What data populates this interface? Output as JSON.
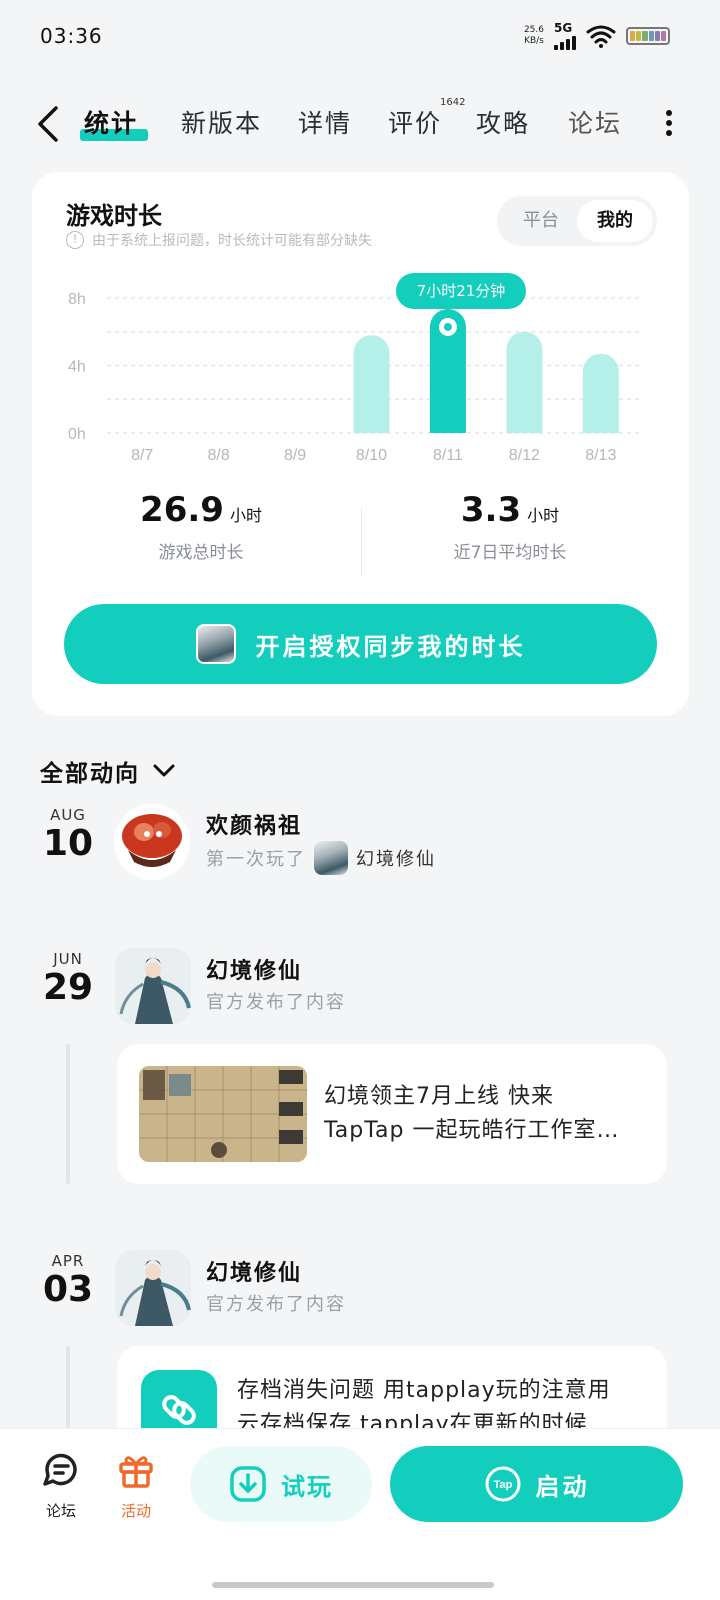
{
  "status_bar": {
    "time": "03:36",
    "net_speed_value": "25.6",
    "net_speed_unit": "KB/s",
    "network": "5G"
  },
  "nav": {
    "tabs": [
      {
        "label": "统计",
        "active": true
      },
      {
        "label": "新版本"
      },
      {
        "label": "详情"
      },
      {
        "label": "评价",
        "badge": "1642"
      },
      {
        "label": "攻略"
      },
      {
        "label": "论坛"
      }
    ]
  },
  "playtime_card": {
    "title": "游戏时长",
    "note": "由于系统上报问题，时长统计可能有部分缺失",
    "toggle": {
      "platform": "平台",
      "mine": "我的",
      "selected": "我的"
    },
    "tooltip": "7小时21分钟",
    "stats": {
      "total_value": "26.9",
      "total_unit": "小时",
      "total_label": "游戏总时长",
      "avg_value": "3.3",
      "avg_unit": "小时",
      "avg_label": "近7日平均时长"
    },
    "sync_button": "开启授权同步我的时长"
  },
  "chart_data": {
    "type": "bar",
    "categories": [
      "8/7",
      "8/8",
      "8/9",
      "8/10",
      "8/11",
      "8/12",
      "8/13"
    ],
    "values": [
      0,
      0,
      0,
      5.8,
      7.35,
      6.0,
      4.7
    ],
    "highlighted_index": 4,
    "yticks": [
      "8h",
      "4h",
      "0h"
    ],
    "ytick_values": [
      8,
      4,
      0
    ],
    "ylim": [
      0,
      8
    ],
    "grid": true,
    "colors": {
      "bar": "#b4efe9",
      "highlight": "#14cebd"
    }
  },
  "activity": {
    "filter": "全部动向",
    "items": [
      {
        "month": "AUG",
        "day": "10",
        "name": "欢颜祸祖",
        "desc_prefix": "第一次玩了",
        "desc_game": "幻境修仙"
      },
      {
        "month": "JUN",
        "day": "29",
        "name": "幻境修仙",
        "desc": "官方发布了内容",
        "post_text_1": "幻境领主7月上线 快来",
        "post_text_2": "TapTap 一起玩皓行工作室…"
      },
      {
        "month": "APR",
        "day": "03",
        "name": "幻境修仙",
        "desc": "官方发布了内容",
        "post_text_1": "存档消失问题 用tapplay玩的注意用",
        "post_text_2": "云存档保存 tapplay在更新的时候"
      }
    ]
  },
  "bottom_bar": {
    "forum": "论坛",
    "events": "活动",
    "trial": "试玩",
    "launch": "启动",
    "launch_icon_text": "Tap"
  },
  "colors": {
    "accent": "#14cebd",
    "events": "#f06a2a"
  }
}
